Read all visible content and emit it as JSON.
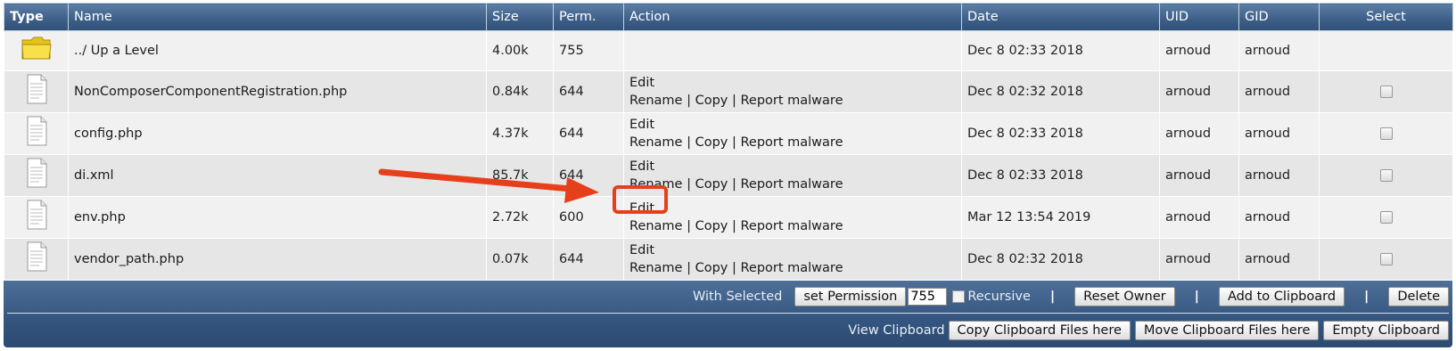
{
  "table": {
    "headers": [
      "Type",
      "Name",
      "Size",
      "Perm.",
      "Action",
      "Date",
      "UID",
      "GID",
      "Select"
    ],
    "rows": [
      {
        "icon": "folder-icon",
        "name": "../ Up a Level",
        "size": "4.00k",
        "perm": "755",
        "edit": "",
        "rename": "",
        "copy": "",
        "report": "",
        "date": "Dec 8 02:33 2018",
        "uid": "arnoud",
        "gid": "arnoud"
      },
      {
        "icon": "file-icon",
        "name": "NonComposerComponentRegistration.php",
        "size": "0.84k",
        "perm": "644",
        "edit": "Edit",
        "rename": "Rename",
        "copy": "Copy",
        "report": "Report malware",
        "date": "Dec 8 02:32 2018",
        "uid": "arnoud",
        "gid": "arnoud"
      },
      {
        "icon": "file-icon",
        "name": "config.php",
        "size": "4.37k",
        "perm": "644",
        "edit": "Edit",
        "rename": "Rename",
        "copy": "Copy",
        "report": "Report malware",
        "date": "Dec 8 02:33 2018",
        "uid": "arnoud",
        "gid": "arnoud"
      },
      {
        "icon": "file-icon",
        "name": "di.xml",
        "size": "85.7k",
        "perm": "644",
        "edit": "Edit",
        "rename": "Rename",
        "copy": "Copy",
        "report": "Report malware",
        "date": "Dec 8 02:33 2018",
        "uid": "arnoud",
        "gid": "arnoud"
      },
      {
        "icon": "file-icon",
        "name": "env.php",
        "size": "2.72k",
        "perm": "600",
        "edit": "Edit",
        "rename": "Rename",
        "copy": "Copy",
        "report": "Report malware",
        "date": "Mar 12 13:54 2019",
        "uid": "arnoud",
        "gid": "arnoud"
      },
      {
        "icon": "file-icon",
        "name": "vendor_path.php",
        "size": "0.07k",
        "perm": "644",
        "edit": "Edit",
        "rename": "Rename",
        "copy": "Copy",
        "report": "Report malware",
        "date": "Dec 8 02:32 2018",
        "uid": "arnoud",
        "gid": "arnoud"
      }
    ],
    "separator": "|"
  },
  "bulk_bar": {
    "with_selected_label": "With Selected",
    "set_permission_label": "set Permission",
    "permission_value": "755",
    "recursive_label": "Recursive",
    "reset_owner_label": "Reset Owner",
    "add_clipboard_label": "Add to Clipboard",
    "delete_label": "Delete",
    "pipe": "|",
    "view_clipboard_label": "View Clipboard",
    "copy_clipboard_label": "Copy Clipboard Files here",
    "move_clipboard_label": "Move Clipboard Files here",
    "empty_clipboard_label": "Empty Clipboard"
  },
  "colors": {
    "header_blue": "#3e6089",
    "annotation_red": "#e5401b"
  }
}
